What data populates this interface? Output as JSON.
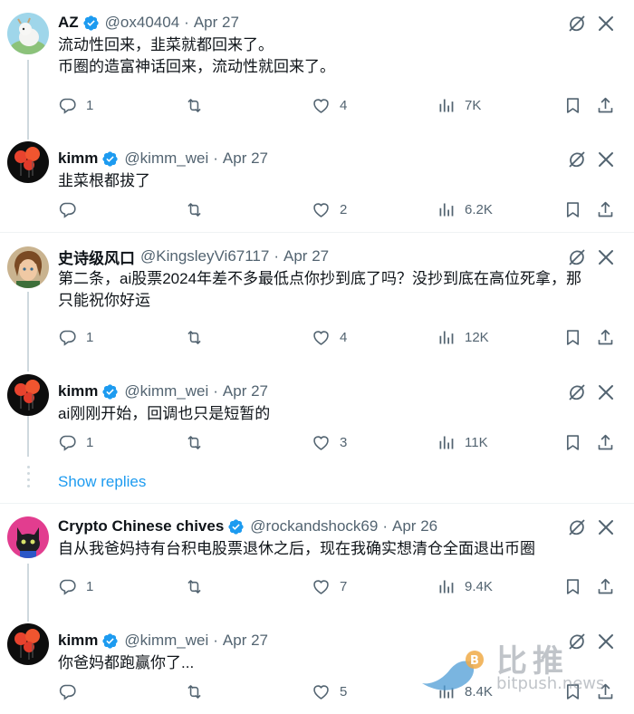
{
  "colors": {
    "accent": "#1d9bf0",
    "text": "#0f1419",
    "muted": "#536471",
    "line": "#cfd9de",
    "divider": "#eff3f4"
  },
  "tweets": [
    {
      "name": "AZ",
      "handle": "@ox40404",
      "date": "Apr 27",
      "lines": [
        "流动性回来，韭菜就都回来了。",
        "币圈的造富神话回来，流动性就回来了。"
      ],
      "replies": "1",
      "reposts": "",
      "likes": "4",
      "views": "7K",
      "avatar": "goat"
    },
    {
      "name": "kimm",
      "handle": "@kimm_wei",
      "date": "Apr 27",
      "lines": [
        "韭菜根都拔了"
      ],
      "replies": "",
      "reposts": "",
      "likes": "2",
      "views": "6.2K",
      "avatar": "balloons"
    },
    {
      "name": "史诗级风口",
      "handle": "@KingsleyVi67117",
      "date": "Apr 27",
      "lines": [
        "第二条，ai股票2024年差不多最低点你抄到底了吗？没抄到底在高位死拿，那",
        "只能祝你好运"
      ],
      "replies": "1",
      "reposts": "",
      "likes": "4",
      "views": "12K",
      "avatar": "anime"
    },
    {
      "name": "kimm",
      "handle": "@kimm_wei",
      "date": "Apr 27",
      "lines": [
        "ai刚刚开始，回调也只是短暂的"
      ],
      "replies": "1",
      "reposts": "",
      "likes": "3",
      "views": "11K",
      "avatar": "balloons"
    },
    {
      "name": "Crypto Chinese chives",
      "handle": "@rockandshock69",
      "date": "Apr 26",
      "lines": [
        "自从我爸妈持有台积电股票退休之后，现在我确实想清仓全面退出币圈"
      ],
      "replies": "1",
      "reposts": "",
      "likes": "7",
      "views": "9.4K",
      "avatar": "cat"
    },
    {
      "name": "kimm",
      "handle": "@kimm_wei",
      "date": "Apr 27",
      "lines": [
        "你爸妈都跑赢你了..."
      ],
      "replies": "",
      "reposts": "",
      "likes": "5",
      "views": "8.4K",
      "avatar": "balloons"
    }
  ],
  "show_replies_label": "Show replies",
  "watermark": {
    "cn": "比推",
    "en": "bitpush.news"
  }
}
